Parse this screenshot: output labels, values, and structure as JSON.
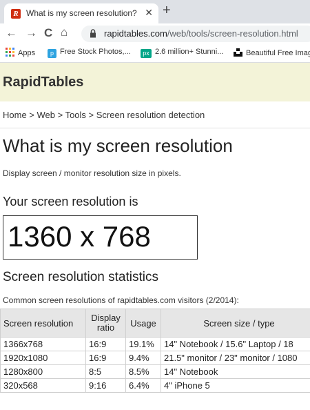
{
  "browser": {
    "tab_title": "What is my screen resolution?",
    "tab_favicon": "R",
    "url_domain": "rapidtables.com",
    "url_path": "/web/tools/screen-resolution.html",
    "bookmarks": [
      {
        "label": "Apps",
        "icon": "apps-grid-icon",
        "color": "#e8453c"
      },
      {
        "label": "Free Stock Photos,...",
        "icon": "p",
        "color": "#2ea3e0"
      },
      {
        "label": "2.6 million+ Stunni...",
        "icon": "px",
        "color": "#03a688"
      },
      {
        "label": "Beautiful Free Imag",
        "icon": "unsplash-icon",
        "color": "#111111"
      }
    ]
  },
  "site": {
    "logo": "RapidTables",
    "breadcrumb": "Home > Web > Tools > Screen resolution detection",
    "title": "What is my screen resolution",
    "description": "Display screen / monitor resolution size in pixels.",
    "result_heading": "Your screen resolution is",
    "resolution": "1360 x 768",
    "stats_heading": "Screen resolution statistics",
    "stats_desc": "Common screen resolutions of rapidtables.com visitors (2/2014):"
  },
  "table": {
    "headers": [
      "Screen resolution",
      "Display ratio",
      "Usage",
      "Screen size / type"
    ],
    "rows": [
      [
        "1366x768",
        "16:9",
        "19.1%",
        "14\" Notebook / 15.6\" Laptop / 18"
      ],
      [
        "1920x1080",
        "16:9",
        "9.4%",
        "21.5\" monitor / 23\" monitor / 1080"
      ],
      [
        "1280x800",
        "8:5",
        "8.5%",
        "14\" Notebook"
      ],
      [
        "320x568",
        "9:16",
        "6.4%",
        "4\" iPhone 5"
      ]
    ]
  }
}
